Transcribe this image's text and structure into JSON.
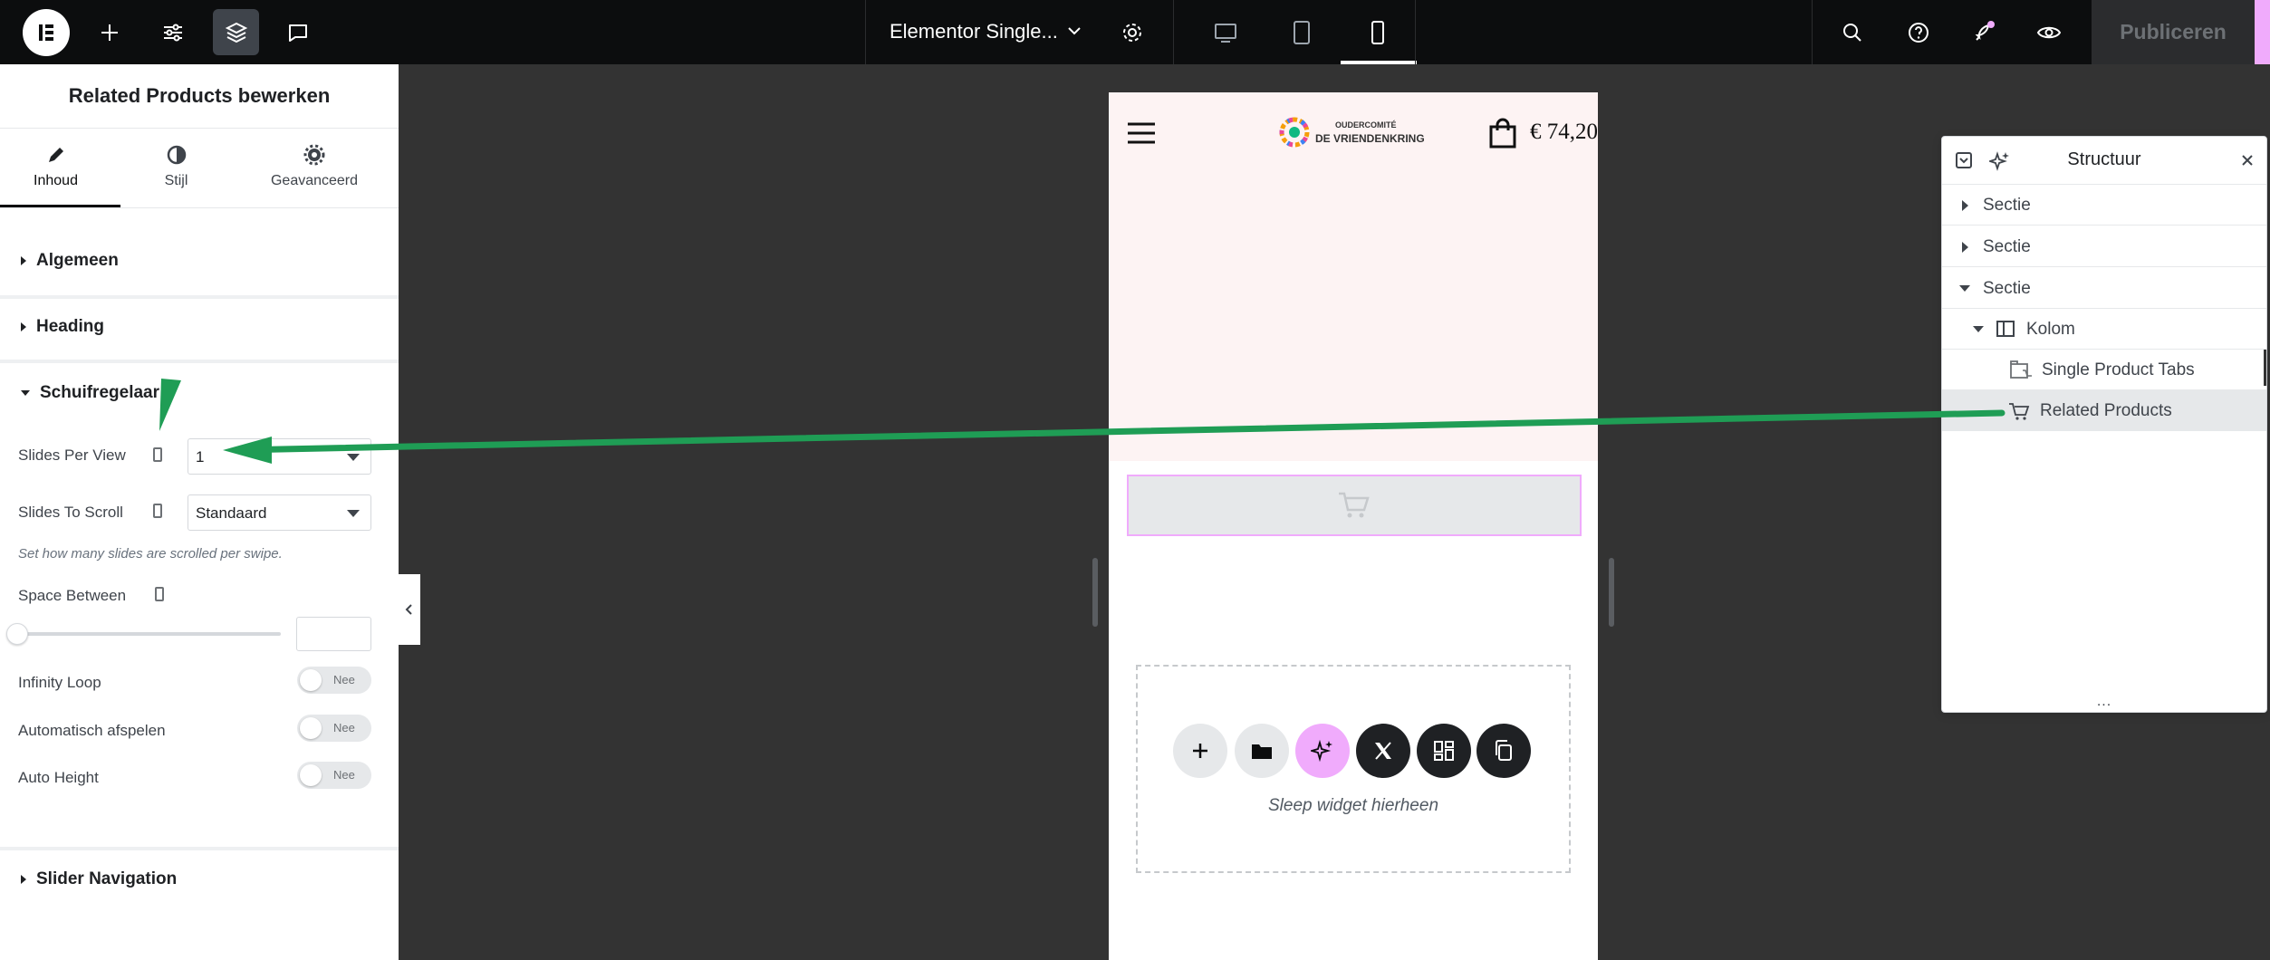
{
  "topbar": {
    "document_title": "Elementor Single...",
    "publish_label": "Publiceren"
  },
  "panel": {
    "title": "Related Products bewerken",
    "tabs": [
      {
        "label": "Inhoud",
        "icon": "pencil-icon"
      },
      {
        "label": "Stijl",
        "icon": "half-circle-icon"
      },
      {
        "label": "Geavanceerd",
        "icon": "gear-icon"
      }
    ],
    "sections": {
      "algemeen": "Algemeen",
      "heading": "Heading",
      "schuifregelaar": "Schuifregelaar",
      "slider_navigation": "Slider Navigation"
    },
    "controls": {
      "slides_per_view_label": "Slides Per View",
      "slides_per_view_value": "1",
      "slides_to_scroll_label": "Slides To Scroll",
      "slides_to_scroll_value": "Standaard",
      "slides_to_scroll_desc": "Set how many slides are scrolled per swipe.",
      "space_between_label": "Space Between",
      "infinity_loop_label": "Infinity Loop",
      "infinity_loop_value": "Nee",
      "autoplay_label": "Automatisch afspelen",
      "autoplay_value": "Nee",
      "auto_height_label": "Auto Height",
      "auto_height_value": "Nee"
    }
  },
  "canvas": {
    "logo_line1": "OUDERCOMITÉ",
    "logo_line2": "DE VRIENDENKRING",
    "cart_total": "€ 74,20",
    "drop_text": "Sleep widget hierheen"
  },
  "navigator": {
    "title": "Structuur",
    "rows": [
      {
        "label": "Sectie"
      },
      {
        "label": "Sectie"
      },
      {
        "label": "Sectie"
      },
      {
        "label": "Kolom"
      },
      {
        "label": "Single Product Tabs"
      },
      {
        "label": "Related Products"
      }
    ],
    "footer_dots": "..."
  },
  "colors": {
    "accent_pink": "#f0abfc",
    "annotation_green": "#1f9d55",
    "topbar_bg": "#0c0d0e"
  }
}
